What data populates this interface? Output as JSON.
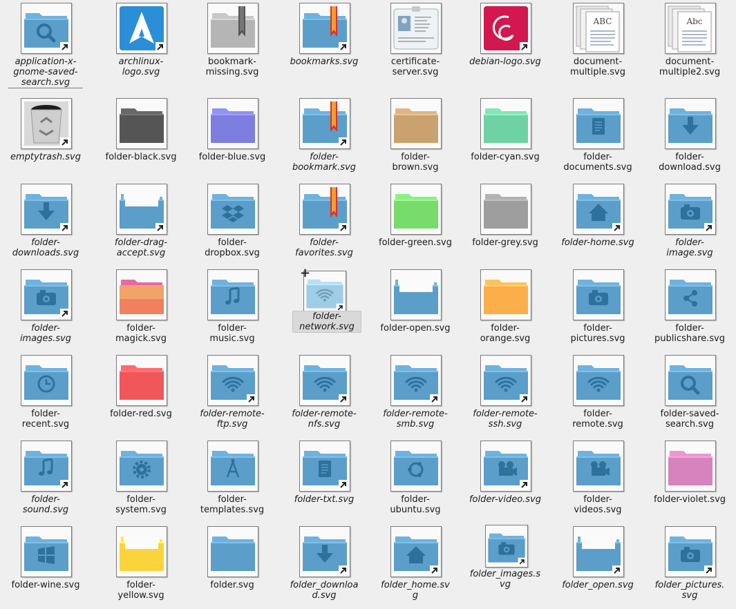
{
  "files": [
    {
      "label": "application-x-gnome-saved-search.svg",
      "kind": "folder",
      "color": "#5b9ec9",
      "glyph": "search",
      "link": true
    },
    {
      "label": "archlinux-logo.svg",
      "kind": "arch",
      "link": true
    },
    {
      "label": "bookmark-missing.svg",
      "kind": "folder",
      "color": "#b5b5b5",
      "glyph": "ribbon-grey",
      "link": false
    },
    {
      "label": "bookmarks.svg",
      "kind": "folder",
      "color": "#5b9ec9",
      "glyph": "ribbon",
      "link": true
    },
    {
      "label": "certificate-server.svg",
      "kind": "card",
      "link": false
    },
    {
      "label": "debian-logo.svg",
      "kind": "debian",
      "link": true
    },
    {
      "label": "document-multiple.svg",
      "kind": "docs",
      "glyph_text": "ABC",
      "link": false
    },
    {
      "label": "document-multiple2.svg",
      "kind": "docs",
      "glyph_text": "Abc",
      "link": false
    },
    {
      "label": "emptytrash.svg",
      "kind": "trash",
      "link": true
    },
    {
      "label": "folder-black.svg",
      "kind": "folder",
      "color": "#555555",
      "link": false
    },
    {
      "label": "folder-blue.svg",
      "kind": "folder",
      "color": "#7d7ee0",
      "link": false
    },
    {
      "label": "folder-bookmark.svg",
      "kind": "folder",
      "color": "#5b9ec9",
      "glyph": "ribbon",
      "link": true
    },
    {
      "label": "folder-brown.svg",
      "kind": "folder",
      "color": "#c9a270",
      "link": false
    },
    {
      "label": "folder-cyan.svg",
      "kind": "folder",
      "color": "#6fd2a4",
      "link": false
    },
    {
      "label": "folder-documents.svg",
      "kind": "folder",
      "color": "#5b9ec9",
      "glyph": "doc",
      "link": false
    },
    {
      "label": "folder-download.svg",
      "kind": "folder",
      "color": "#5b9ec9",
      "glyph": "down",
      "link": false
    },
    {
      "label": "folder-downloads.svg",
      "kind": "folder",
      "color": "#5b9ec9",
      "glyph": "down",
      "link": true
    },
    {
      "label": "folder-drag-accept.svg",
      "kind": "folder",
      "color": "#5b9ec9",
      "glyph": "open",
      "link": true
    },
    {
      "label": "folder-dropbox.svg",
      "kind": "folder",
      "color": "#5b9ec9",
      "glyph": "dropbox",
      "link": false
    },
    {
      "label": "folder-favorites.svg",
      "kind": "folder",
      "color": "#5b9ec9",
      "glyph": "ribbon",
      "link": true
    },
    {
      "label": "folder-green.svg",
      "kind": "folder",
      "color": "#78dc6c",
      "link": false
    },
    {
      "label": "folder-grey.svg",
      "kind": "folder",
      "color": "#9e9e9e",
      "link": false
    },
    {
      "label": "folder-home.svg",
      "kind": "folder",
      "color": "#5b9ec9",
      "glyph": "home",
      "link": true
    },
    {
      "label": "folder-image.svg",
      "kind": "folder",
      "color": "#5b9ec9",
      "glyph": "camera",
      "link": true
    },
    {
      "label": "folder-images.svg",
      "kind": "folder",
      "color": "#5b9ec9",
      "glyph": "camera",
      "link": true
    },
    {
      "label": "folder-magick.svg",
      "kind": "folder",
      "color": "#ec7565",
      "glyph": "magick",
      "link": false
    },
    {
      "label": "folder-music.svg",
      "kind": "folder",
      "color": "#5b9ec9",
      "glyph": "music",
      "link": false
    },
    {
      "label": "folder-network.svg",
      "kind": "folder",
      "color": "#9fcde6",
      "glyph": "wifi",
      "link": true,
      "selected": true
    },
    {
      "label": "folder-open.svg",
      "kind": "folder",
      "color": "#5b9ec9",
      "glyph": "open",
      "link": false
    },
    {
      "label": "folder-orange.svg",
      "kind": "folder",
      "color": "#fbae4a",
      "link": false
    },
    {
      "label": "folder-pictures.svg",
      "kind": "folder",
      "color": "#5b9ec9",
      "glyph": "camera",
      "link": false
    },
    {
      "label": "folder-publicshare.svg",
      "kind": "folder",
      "color": "#5b9ec9",
      "glyph": "share",
      "link": false
    },
    {
      "label": "folder-recent.svg",
      "kind": "folder",
      "color": "#5b9ec9",
      "glyph": "clock",
      "link": false
    },
    {
      "label": "folder-red.svg",
      "kind": "folder",
      "color": "#f0575a",
      "link": false
    },
    {
      "label": "folder-remote-ftp.svg",
      "kind": "folder",
      "color": "#5b9ec9",
      "glyph": "wifi",
      "link": true
    },
    {
      "label": "folder-remote-nfs.svg",
      "kind": "folder",
      "color": "#5b9ec9",
      "glyph": "wifi",
      "link": true
    },
    {
      "label": "folder-remote-smb.svg",
      "kind": "folder",
      "color": "#5b9ec9",
      "glyph": "wifi",
      "link": true
    },
    {
      "label": "folder-remote-ssh.svg",
      "kind": "folder",
      "color": "#5b9ec9",
      "glyph": "wifi",
      "link": true
    },
    {
      "label": "folder-remote.svg",
      "kind": "folder",
      "color": "#5b9ec9",
      "glyph": "wifi",
      "link": false
    },
    {
      "label": "folder-saved-search.svg",
      "kind": "folder",
      "color": "#5b9ec9",
      "glyph": "search",
      "link": false
    },
    {
      "label": "folder-sound.svg",
      "kind": "folder",
      "color": "#5b9ec9",
      "glyph": "music",
      "link": true
    },
    {
      "label": "folder-system.svg",
      "kind": "folder",
      "color": "#5b9ec9",
      "glyph": "gear",
      "link": false
    },
    {
      "label": "folder-templates.svg",
      "kind": "folder",
      "color": "#5b9ec9",
      "glyph": "compass",
      "link": false
    },
    {
      "label": "folder-txt.svg",
      "kind": "folder",
      "color": "#5b9ec9",
      "glyph": "doc",
      "link": true
    },
    {
      "label": "folder-ubuntu.svg",
      "kind": "folder",
      "color": "#5b9ec9",
      "glyph": "ubuntu",
      "link": false
    },
    {
      "label": "folder-video.svg",
      "kind": "folder",
      "color": "#5b9ec9",
      "glyph": "film",
      "link": true
    },
    {
      "label": "folder-videos.svg",
      "kind": "folder",
      "color": "#5b9ec9",
      "glyph": "film",
      "link": false
    },
    {
      "label": "folder-violet.svg",
      "kind": "folder",
      "color": "#d783bd",
      "link": false
    },
    {
      "label": "folder-wine.svg",
      "kind": "folder",
      "color": "#5b9ec9",
      "glyph": "windows",
      "link": false
    },
    {
      "label": "folder-yellow.svg",
      "kind": "folder",
      "color": "#fbd43d",
      "glyph": "open",
      "link": false
    },
    {
      "label": "folder.svg",
      "kind": "folder",
      "color": "#5b9ec9",
      "link": false
    },
    {
      "label": "folder_download.svg",
      "kind": "folder",
      "color": "#5b9ec9",
      "glyph": "down",
      "link": true
    },
    {
      "label": "folder_home.svg",
      "kind": "folder",
      "color": "#5b9ec9",
      "glyph": "home",
      "link": true
    },
    {
      "label": "folder_images.svg",
      "kind": "folder",
      "color": "#5b9ec9",
      "glyph": "camera",
      "link": true,
      "small": true
    },
    {
      "label": "folder_open.svg",
      "kind": "folder",
      "color": "#5b9ec9",
      "glyph": "open",
      "link": true
    },
    {
      "label": "folder_pictures.svg",
      "kind": "folder",
      "color": "#5b9ec9",
      "glyph": "camera",
      "link": true
    }
  ]
}
